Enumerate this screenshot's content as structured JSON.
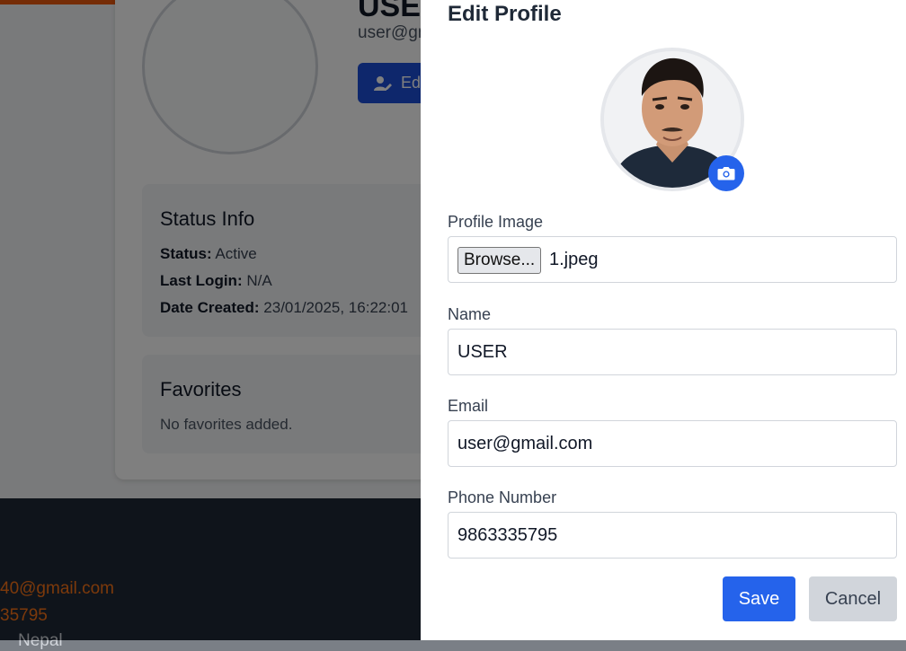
{
  "background": {
    "name": "USER",
    "email": "user@gmail.com",
    "edit_button_label": "Edit",
    "status_info": {
      "title": "Status Info",
      "status_label": "Status:",
      "status_value": "Active",
      "last_login_label": "Last Login:",
      "last_login_value": "N/A",
      "date_created_label": "Date Created:",
      "date_created_value": "23/01/2025, 16:22:01"
    },
    "favorites": {
      "title": "Favorites",
      "empty_text": "No favorites added."
    },
    "footer": {
      "email_fragment": "40@gmail.com",
      "phone_fragment": "35795",
      "more_fragment": "Nepal"
    }
  },
  "drawer": {
    "title": "Edit Profile",
    "profile_image": {
      "label": "Profile Image",
      "browse_label": "Browse...",
      "file_name": "1.jpeg"
    },
    "name": {
      "label": "Name",
      "value": "USER"
    },
    "email": {
      "label": "Email",
      "value": "user@gmail.com"
    },
    "phone": {
      "label": "Phone Number",
      "value": "9863335795"
    },
    "save_label": "Save",
    "cancel_label": "Cancel"
  },
  "colors": {
    "primary": "#2563eb",
    "accent": "#ea580c",
    "footer_bg": "#1f2937"
  },
  "icons": [
    "user-edit-icon",
    "camera-icon"
  ]
}
